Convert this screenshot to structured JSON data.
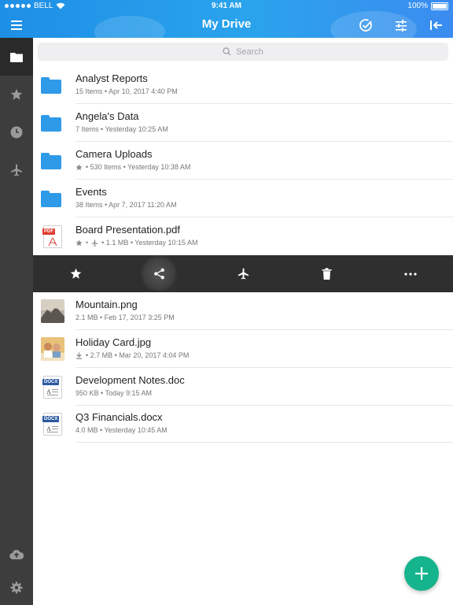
{
  "status_bar": {
    "carrier": "BELL",
    "time": "9:41 AM",
    "battery": "100%"
  },
  "header": {
    "title": "My Drive"
  },
  "search": {
    "placeholder": "Search"
  },
  "files": [
    {
      "name": "Analyst Reports",
      "meta": "15 Items  •  Apr 10, 2017 4:40 PM",
      "type": "folder"
    },
    {
      "name": "Angela's Data",
      "meta": "7 Items  •  Yesterday 10:25 AM",
      "type": "folder"
    },
    {
      "name": "Camera Uploads",
      "meta": "•  530 Items  •  Yesterday 10:38 AM",
      "type": "folder",
      "starred": true
    },
    {
      "name": "Events",
      "meta": "38 Items  •  Apr 7, 2017 11:20 AM",
      "type": "folder"
    },
    {
      "name": "Board Presentation.pdf",
      "meta": "•  1.1 MB  •  Yesterday 10:15 AM",
      "type": "pdf",
      "starred": true,
      "offline": true
    },
    {
      "name": "Mountain.png",
      "meta": "2.1 MB  •  Feb 17, 2017 3:25 PM",
      "type": "image"
    },
    {
      "name": "Holiday Card.jpg",
      "meta": "•  2.7 MB  •  Mar 20, 2017 4:04 PM",
      "type": "image",
      "downloaded": true
    },
    {
      "name": "Development Notes.doc",
      "meta": "950 KB  •  Today 9:15 AM",
      "type": "doc"
    },
    {
      "name": "Q3 Financials.docx",
      "meta": "4.0 MB  •  Yesterday 10:45 AM",
      "type": "docx"
    }
  ],
  "badges": {
    "pdf": "PDF",
    "doc": "DOCX",
    "docx": "DOCX"
  },
  "colors": {
    "header": "#2aa3ec",
    "folder": "#2f9ae8",
    "sidebar": "#3d3d3d",
    "action_bar": "#2f2f2f",
    "fab": "#16b48c"
  }
}
